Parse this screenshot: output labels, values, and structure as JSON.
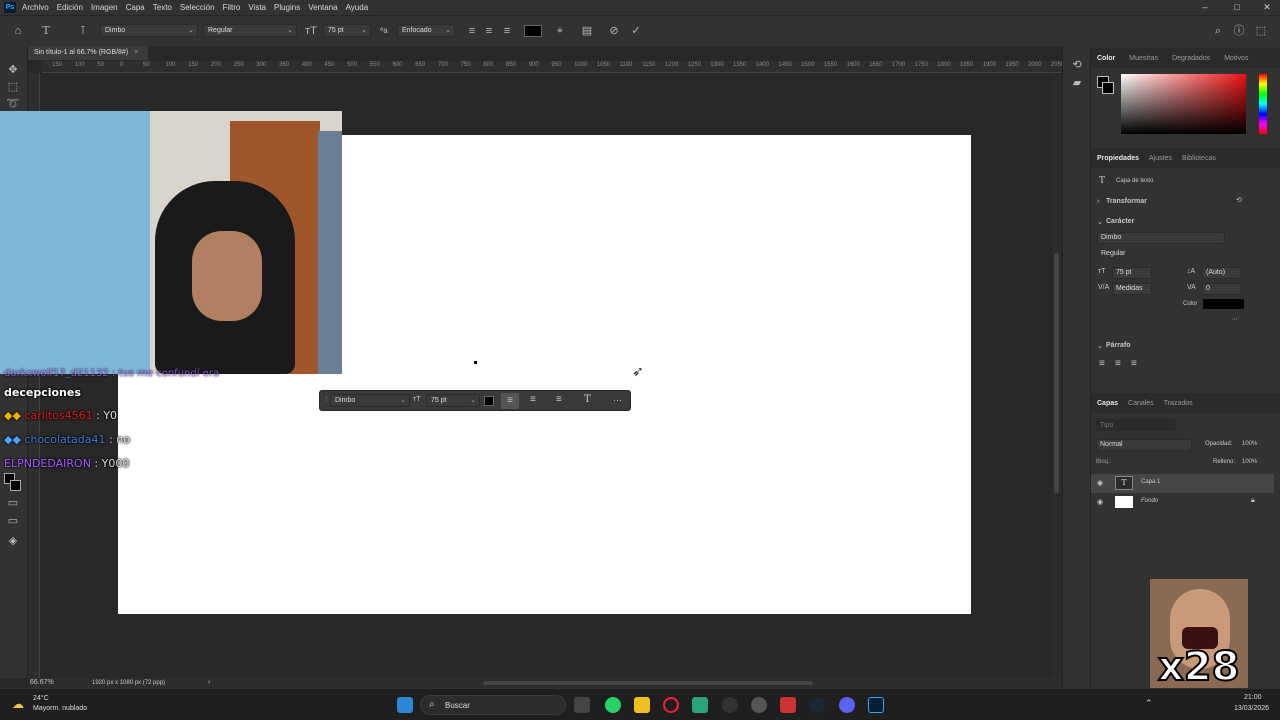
{
  "menubar": {
    "items": [
      "Archivo",
      "Edición",
      "Imagen",
      "Capa",
      "Texto",
      "Selección",
      "Filtro",
      "Vista",
      "Plugins",
      "Ventana",
      "Ayuda"
    ]
  },
  "options": {
    "font_family": "Dimbo",
    "font_style": "Regular",
    "font_size": "75 pt",
    "antialias": "Enfocado"
  },
  "document": {
    "tab_label": "Sin título-1 al 66.7% (RGB/8#)",
    "zoom": "66.67%",
    "doc_info": "1920 px x 1080 px (72 ppp)"
  },
  "ruler": {
    "labels": [
      "150",
      "100",
      "50",
      "0",
      "50",
      "100",
      "150",
      "200",
      "250",
      "300",
      "350",
      "400",
      "450",
      "500",
      "550",
      "600",
      "650",
      "700",
      "750",
      "800",
      "850",
      "900",
      "950",
      "1000",
      "1050",
      "1100",
      "1150",
      "1200",
      "1250",
      "1300",
      "1350",
      "1400",
      "1450",
      "1500",
      "1550",
      "1600",
      "1650",
      "1700",
      "1750",
      "1800",
      "1850",
      "1900",
      "1950",
      "2000",
      "2050"
    ]
  },
  "float_bar": {
    "font_family": "Dimbo",
    "font_size": "75 pt"
  },
  "color_panel": {
    "tabs": [
      "Color",
      "Muestras",
      "Degradados",
      "Motivos"
    ]
  },
  "properties_panel": {
    "tabs": [
      "Propiedades",
      "Ajustes",
      "Bibliotecas"
    ],
    "layer_kind": "Capa de texto",
    "section_transform": "Transformar",
    "section_character": "Carácter",
    "font_family": "Dimbo",
    "font_style": "Regular",
    "font_size": "75 pt",
    "leading": "(Auto)",
    "kerning": "Medidas",
    "tracking": "0",
    "color_label": "Color",
    "section_paragraph": "Párrafo"
  },
  "layers_panel": {
    "tabs": [
      "Capas",
      "Canales",
      "Trazados"
    ],
    "search_placeholder": "Tipo",
    "blend_mode": "Normal",
    "opacity_label": "Opacidad:",
    "opacity_value": "100%",
    "lock_label": "Bloq.:",
    "fill_label": "Relleno:",
    "fill_value": "100%",
    "layers": [
      {
        "name": "Capa 1"
      },
      {
        "name": "Fondo"
      }
    ]
  },
  "chat": {
    "header_partial": "darkxwolf17_d21132 : tus me confundí era",
    "header_line2": "decepciones",
    "messages": [
      {
        "user": "carlitos4561",
        "text": " : Y0"
      },
      {
        "user": "chocolatada41",
        "text": " : no"
      },
      {
        "user": "ELPNDEDAIRON",
        "text": " : Y000"
      }
    ]
  },
  "overlay": {
    "counter": "x28"
  },
  "taskbar": {
    "weather_temp": "24°C",
    "weather_desc": "Mayorm. nublado",
    "search_label": "Buscar",
    "time": "21:00",
    "date": "13/03/2026"
  },
  "colors": {
    "accent": "#31a8ff",
    "panel": "#323232",
    "canvas": "#ffffff"
  }
}
